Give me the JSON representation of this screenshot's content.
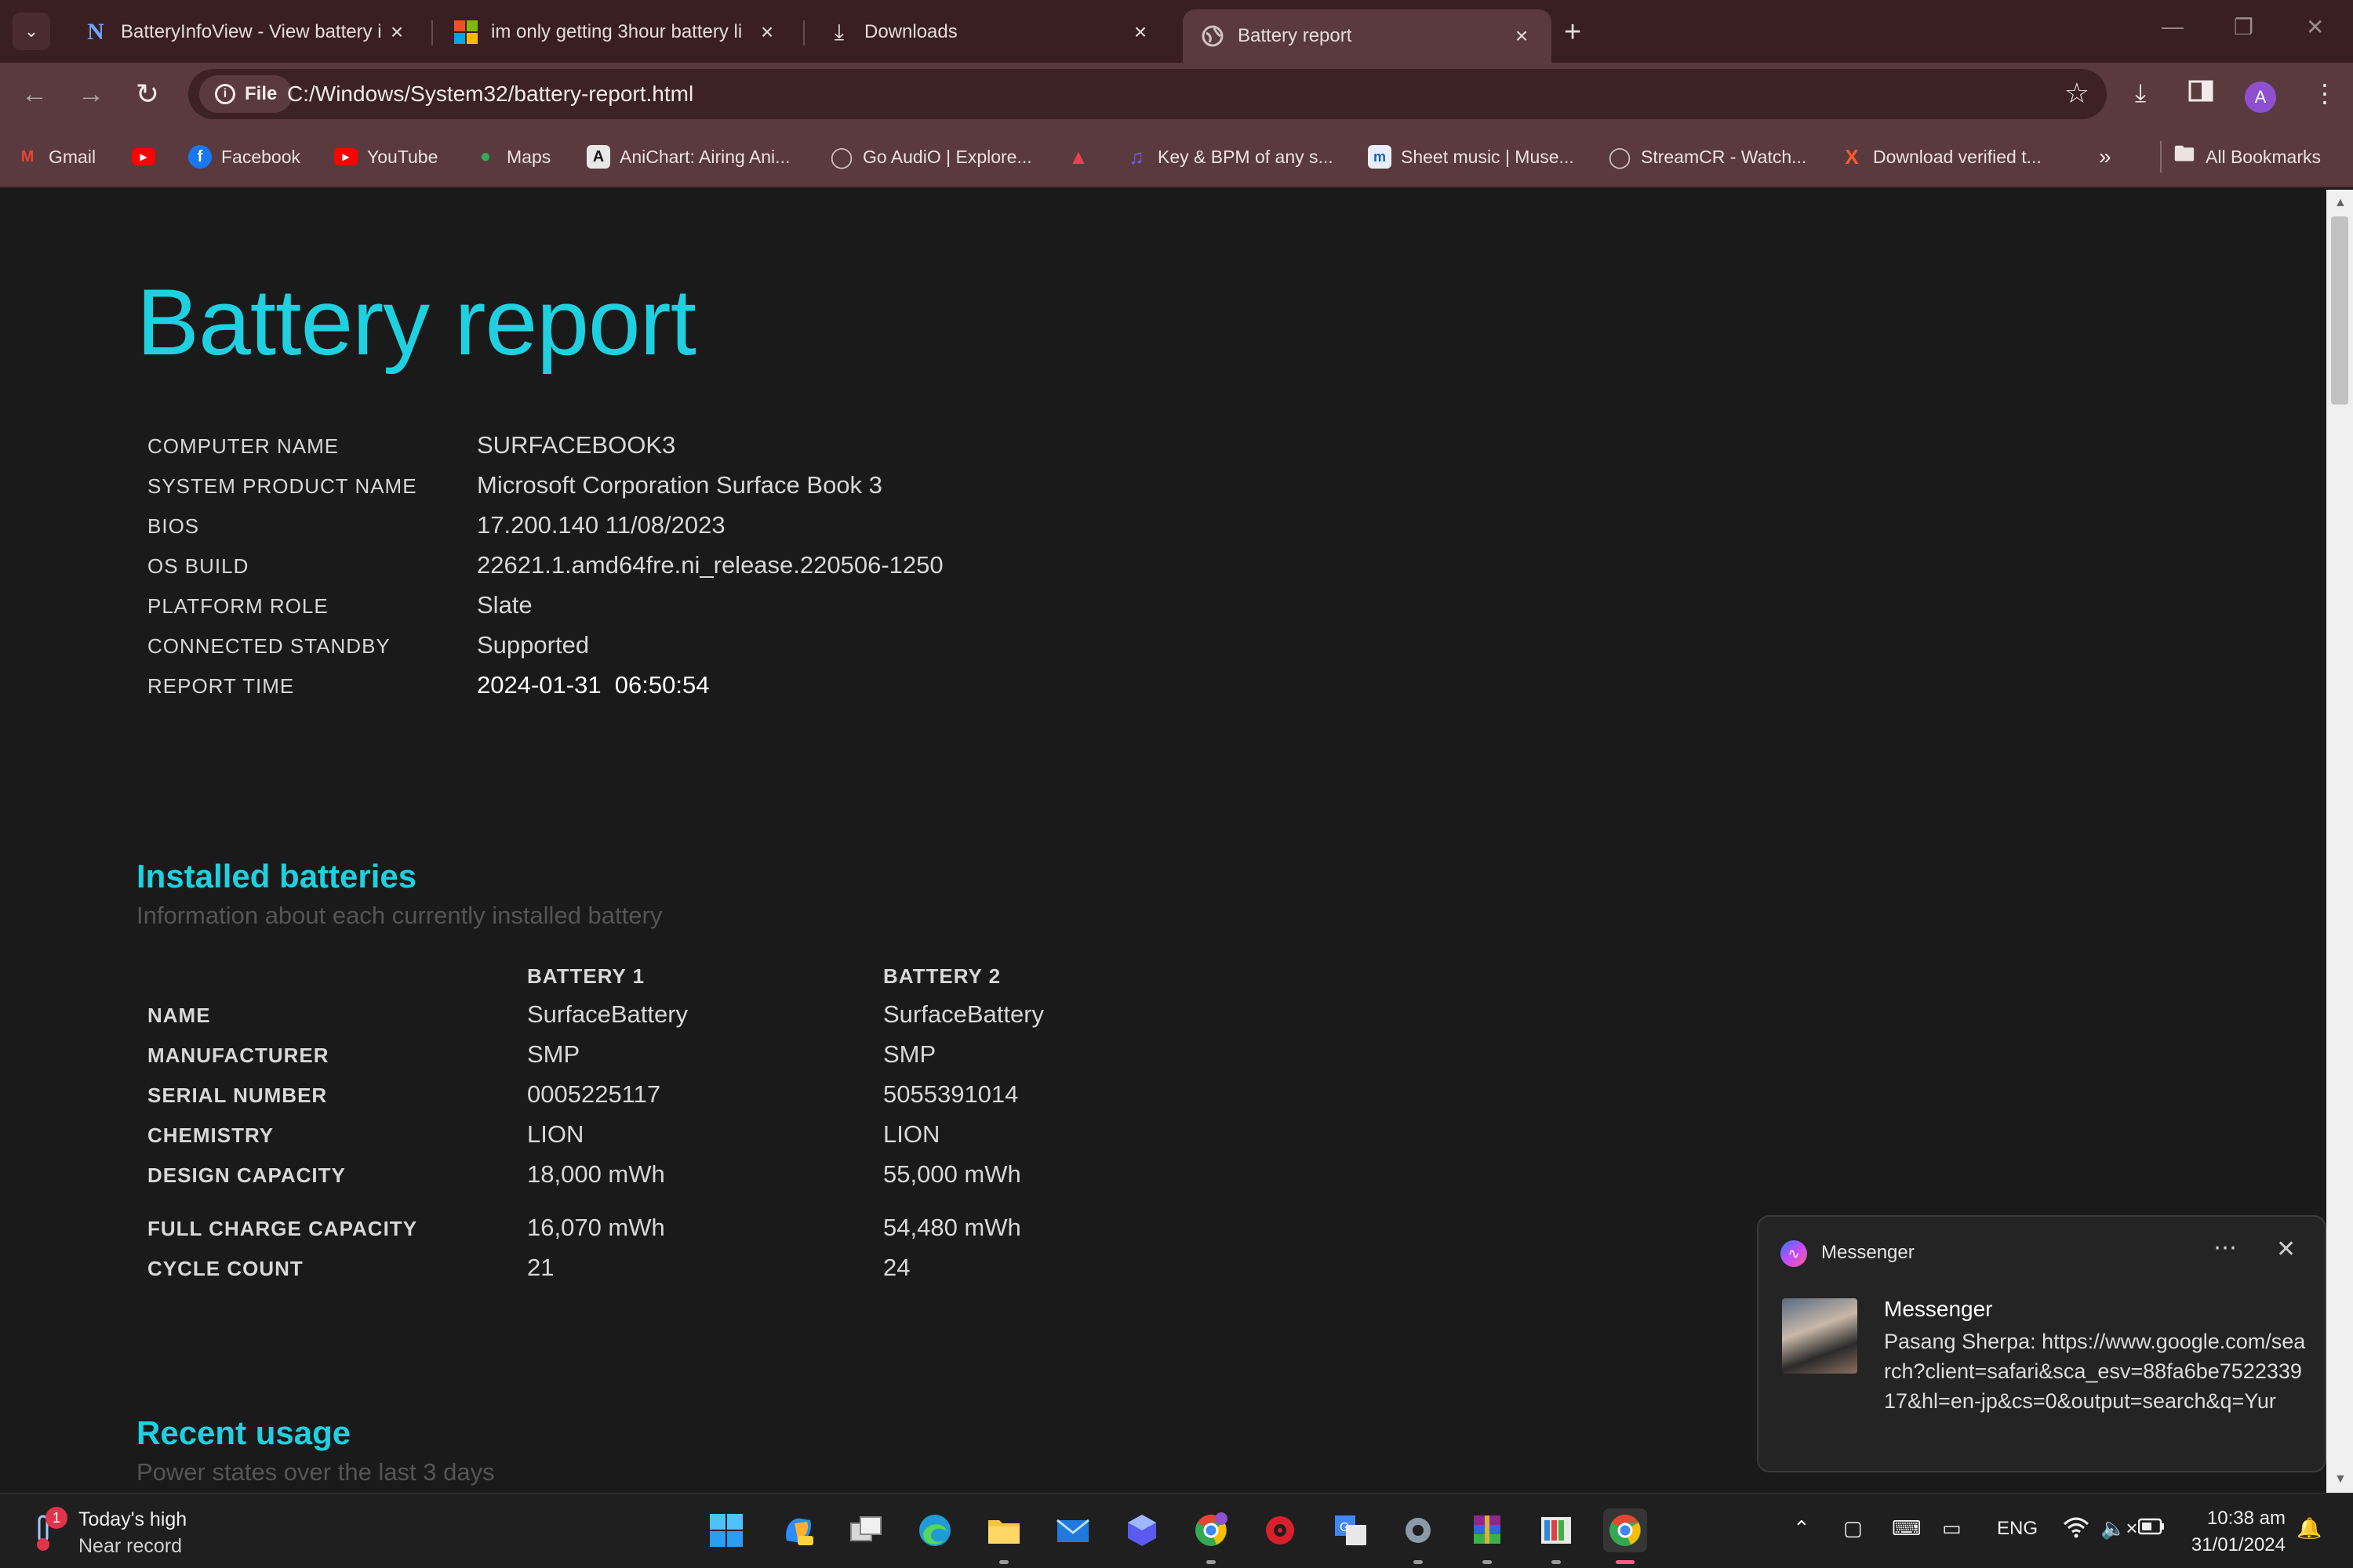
{
  "tabs": [
    {
      "title": "BatteryInfoView - View battery i",
      "icon": "nirsoft-n-icon"
    },
    {
      "title": "im only getting 3hour battery li",
      "icon": "microsoft-logo-icon"
    },
    {
      "title": "Downloads",
      "icon": "download-icon"
    },
    {
      "title": "Battery report",
      "icon": "globe-icon"
    }
  ],
  "toolbar": {
    "site_chip": "File",
    "url": "C:/Windows/System32/battery-report.html",
    "avatar_letter": "A"
  },
  "bookmarks": [
    {
      "label": "Gmail",
      "icon": "gmail-icon"
    },
    {
      "label": "",
      "icon": "youtube-icon"
    },
    {
      "label": "Facebook",
      "icon": "facebook-icon"
    },
    {
      "label": "YouTube",
      "icon": "youtube-icon"
    },
    {
      "label": "Maps",
      "icon": "maps-icon"
    },
    {
      "label": "AniChart: Airing Ani...",
      "icon": "anichart-icon"
    },
    {
      "label": "Go AudiO | Explore...",
      "icon": "globe-icon"
    },
    {
      "label": "",
      "icon": "red-bookmark-icon"
    },
    {
      "label": "Key & BPM of any s...",
      "icon": "key-bpm-icon"
    },
    {
      "label": "Sheet music | Muse...",
      "icon": "musescore-icon"
    },
    {
      "label": "StreamCR - Watch...",
      "icon": "globe-icon"
    },
    {
      "label": "Download verified t...",
      "icon": "x-logo-icon"
    }
  ],
  "bookmarks_all": "All Bookmarks",
  "report": {
    "title": "Battery report",
    "info": [
      {
        "label": "COMPUTER NAME",
        "value": "SURFACEBOOK3"
      },
      {
        "label": "SYSTEM PRODUCT NAME",
        "value": "Microsoft Corporation Surface Book 3"
      },
      {
        "label": "BIOS",
        "value": "17.200.140 11/08/2023"
      },
      {
        "label": "OS BUILD",
        "value": "22621.1.amd64fre.ni_release.220506-1250"
      },
      {
        "label": "PLATFORM ROLE",
        "value": "Slate"
      },
      {
        "label": "CONNECTED STANDBY",
        "value": "Supported"
      },
      {
        "label": "REPORT TIME",
        "value": "2024-01-31  06:50:54"
      }
    ],
    "installed": {
      "title": "Installed batteries",
      "subtitle": "Information about each currently installed battery",
      "headers": [
        "BATTERY 1",
        "BATTERY 2"
      ],
      "rows": [
        {
          "label": "NAME",
          "b1": "SurfaceBattery",
          "b2": "SurfaceBattery"
        },
        {
          "label": "MANUFACTURER",
          "b1": "SMP",
          "b2": "SMP"
        },
        {
          "label": "SERIAL NUMBER",
          "b1": "0005225117",
          "b2": "5055391014"
        },
        {
          "label": "CHEMISTRY",
          "b1": "LION",
          "b2": "LION"
        },
        {
          "label": "DESIGN CAPACITY",
          "b1": "18,000 mWh",
          "b2": "55,000 mWh"
        },
        {
          "label": "FULL CHARGE CAPACITY",
          "b1": "16,070 mWh",
          "b2": "54,480 mWh"
        },
        {
          "label": "CYCLE COUNT",
          "b1": "21",
          "b2": "24"
        }
      ]
    },
    "recent": {
      "title": "Recent usage",
      "subtitle": "Power states over the last 3 days"
    }
  },
  "notification": {
    "app": "Messenger",
    "title": "Messenger",
    "body": "Pasang Sherpa: https://www.google.com/search?client=safari&sca_esv=88fa6be752233917&hl=en-jp&cs=0&output=search&q=Yur"
  },
  "taskbar": {
    "weather_line1": "Today's high",
    "weather_line2": "Near record",
    "weather_badge": "1",
    "language": "ENG",
    "time": "10:38 am",
    "date": "31/01/2024"
  }
}
